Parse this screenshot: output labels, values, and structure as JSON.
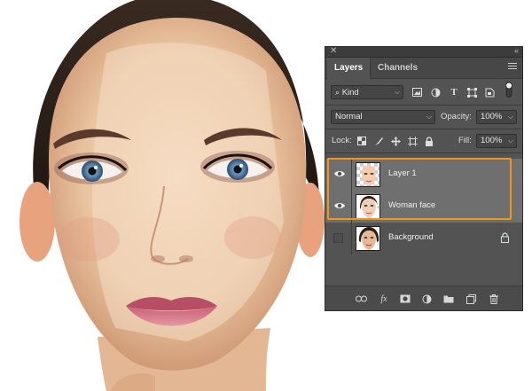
{
  "panel": {
    "tabs": [
      "Layers",
      "Channels"
    ],
    "filter": {
      "icon": "search-icon",
      "value": "Kind"
    },
    "blend_mode": "Normal",
    "opacity": {
      "label": "Opacity:",
      "value": "100%"
    },
    "lock": {
      "label": "Lock:"
    },
    "fill": {
      "label": "Fill:",
      "value": "100%"
    },
    "layers": [
      {
        "name": "Layer 1",
        "visible": true,
        "selected": true,
        "thumb": "transparent-face"
      },
      {
        "name": "Woman face",
        "visible": true,
        "selected": true,
        "thumb": "face-mask"
      },
      {
        "name": "Background",
        "visible": false,
        "selected": false,
        "thumb": "face-photo",
        "locked": true
      }
    ]
  },
  "colors": {
    "panel_bg": "#535353",
    "selection_outline": "#f0961e",
    "selected_row": "#6f6f6f"
  },
  "icons": {
    "filter_icons": [
      "image-filter-icon",
      "adjustment-filter-icon",
      "type-filter-icon",
      "shape-filter-icon",
      "smart-object-filter-icon"
    ],
    "lock_icons": [
      "lock-transparent-pixels-icon",
      "lock-image-pixels-icon",
      "lock-position-icon",
      "lock-artboard-icon",
      "lock-all-icon"
    ],
    "bottom_icons": [
      "link-layers-icon",
      "fx-icon",
      "add-mask-icon",
      "adjustment-layer-icon",
      "new-group-icon",
      "new-layer-icon",
      "trash-icon"
    ]
  }
}
